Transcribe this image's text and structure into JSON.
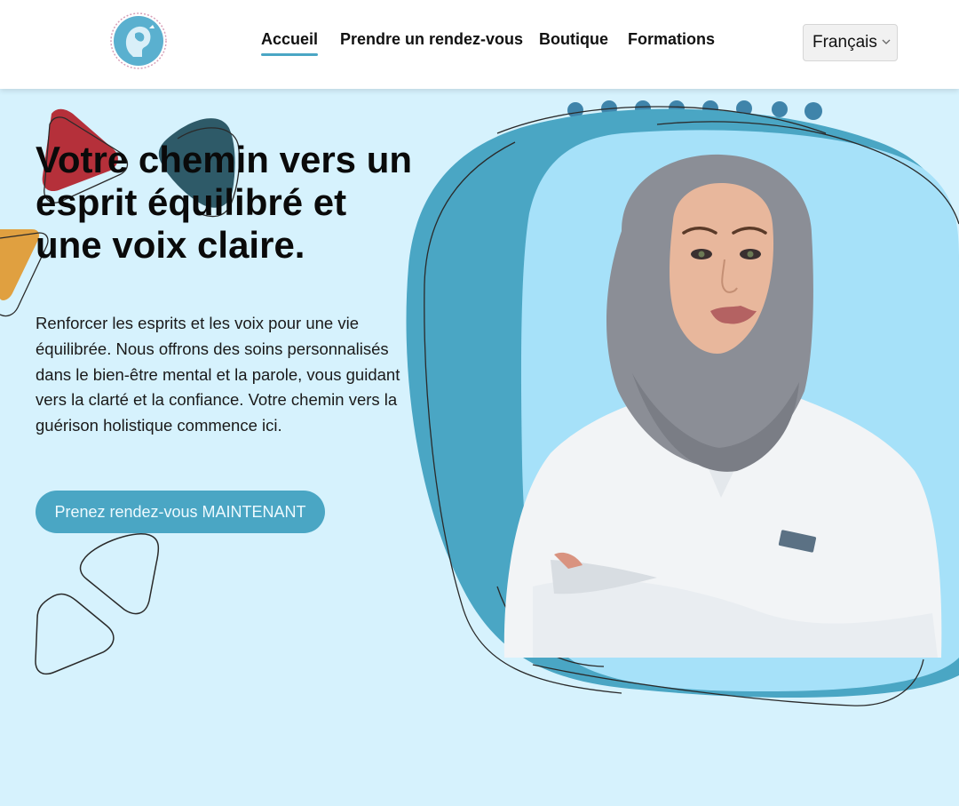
{
  "header": {
    "logo_label": "logo",
    "nav": [
      {
        "label": "Accueil",
        "active": true
      },
      {
        "label": "Prendre un rendez-vous",
        "active": false
      },
      {
        "label": "Boutique",
        "active": false
      },
      {
        "label": "Formations",
        "active": false
      }
    ],
    "language": {
      "selected": "Français"
    }
  },
  "hero": {
    "title_line1": "Votre chemin vers un",
    "title_line2": "esprit équilibré et",
    "title_line3": "une voix claire.",
    "description": "Renforcer les esprits et les voix pour une vie équilibrée. Nous offrons des soins personnalisés dans le bien-être mental et la parole, vous guidant vers la clarté et la confiance. Votre chemin vers la guérison holistique commence ici.",
    "cta_label": "Prenez rendez-vous MAINTENANT"
  },
  "colors": {
    "accent": "#4aa6c4",
    "background": "#d6f2fd",
    "blob_light": "#a6e1f9",
    "triangle_red": "#b5303a",
    "triangle_teal": "#2e5a68",
    "triangle_orange": "#e0a040"
  }
}
